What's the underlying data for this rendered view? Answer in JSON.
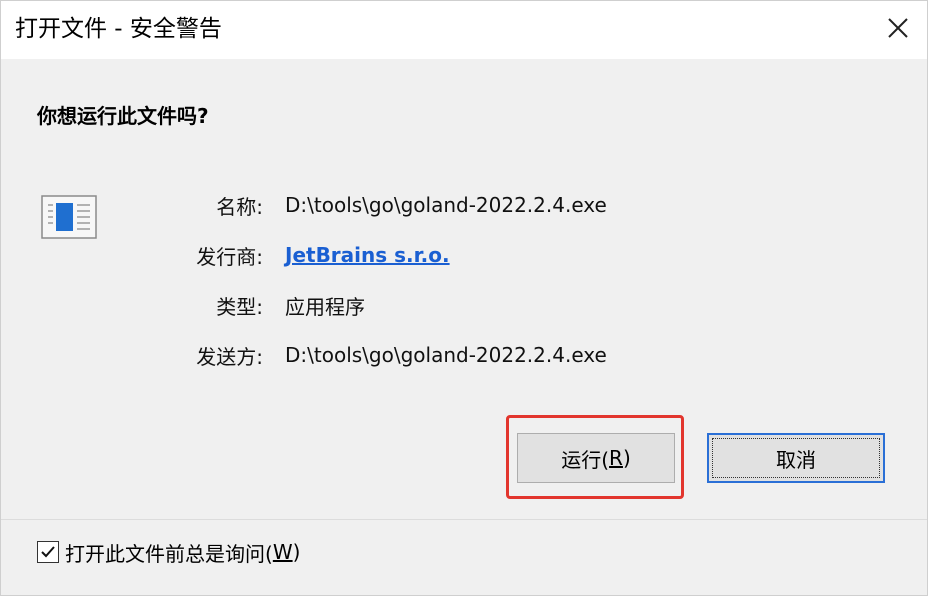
{
  "window": {
    "title": "打开文件 - 安全警告",
    "close_icon": "close-icon"
  },
  "dialog": {
    "question": "你想运行此文件吗?",
    "icon": "application-window-icon",
    "fields": [
      {
        "label": "名称:",
        "value": "D:\\tools\\go\\goland-2022.2.4.exe"
      },
      {
        "label": "发行商:",
        "value": "JetBrains s.r.o."
      },
      {
        "label": "类型:",
        "value": "应用程序"
      },
      {
        "label": "发送方:",
        "value": "D:\\tools\\go\\goland-2022.2.4.exe"
      }
    ]
  },
  "buttons": {
    "run_label_main": "运行(",
    "run_label_key": "R",
    "run_label_end": ")",
    "cancel_label": "取消"
  },
  "checkbox": {
    "checked": true,
    "label_main": "打开此文件前总是询问(",
    "label_key": "W",
    "label_end": ")"
  },
  "colors": {
    "link": "#1a5fd2",
    "highlight": "#e2352d",
    "focus_border": "#2a6fd6"
  }
}
